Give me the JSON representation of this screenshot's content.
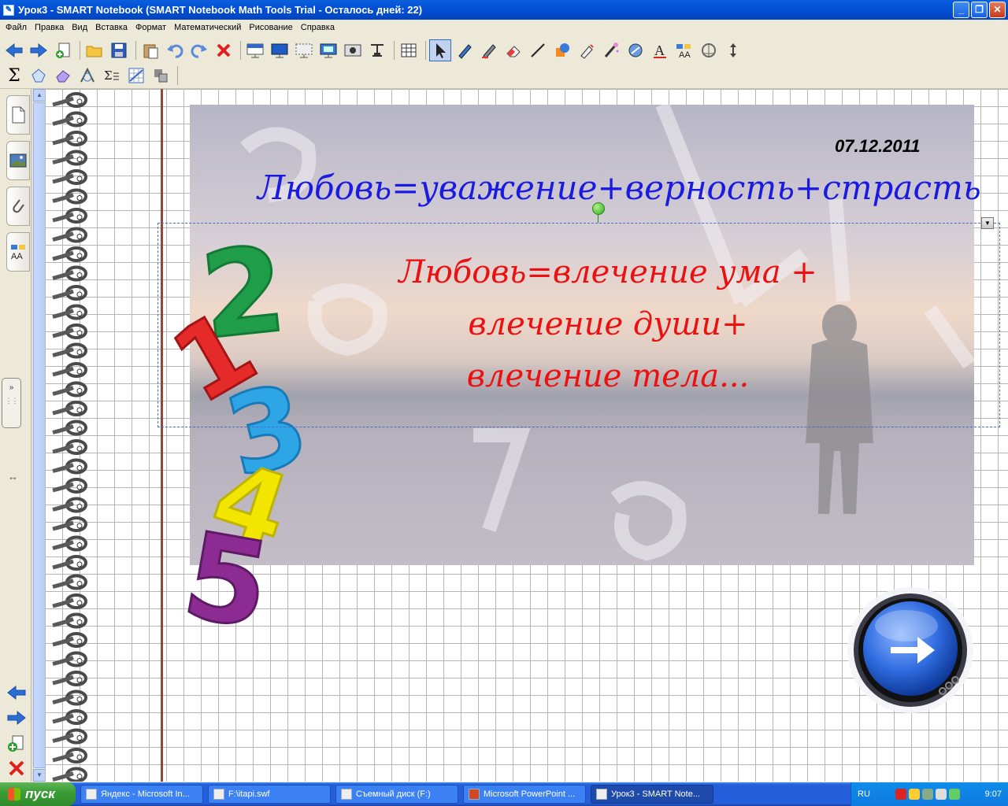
{
  "window": {
    "title": "Урок3 - SMART Notebook (SMART Notebook Math Tools Trial - Осталось дней: 22)"
  },
  "menu": [
    "Файл",
    "Правка",
    "Вид",
    "Вставка",
    "Формат",
    "Математический",
    "Рисование",
    "Справка"
  ],
  "toolbar_icons_row1": [
    "back-arrow-icon",
    "forward-arrow-icon",
    "add-page-icon",
    "open-folder-icon",
    "save-icon",
    "paste-icon",
    "undo-icon",
    "redo-icon",
    "delete-icon",
    "screen-shade-icon",
    "full-screen-icon",
    "transparent-bg-icon",
    "display-icon",
    "capture-icon",
    "document-camera-icon",
    "table-icon",
    "select-pointer-icon",
    "pen-icon",
    "creative-pen-icon",
    "eraser-icon",
    "line-icon",
    "shapes-icon",
    "fill-icon",
    "magic-pen-icon",
    "properties-icon",
    "text-icon",
    "table-text-icon",
    "measure-icon",
    "toolbar-move-icon"
  ],
  "toolbar_icons_row2": [
    "sigma-icon",
    "shape-recognition-icon",
    "eraser-shape-icon",
    "geometry-icon",
    "equation-icon",
    "graph-icon",
    "math-tools-icon"
  ],
  "colors": {
    "title_blue": "#1a1ae0",
    "body_red": "#ec1010"
  },
  "slide": {
    "date": "07.12.2011",
    "title": "Любовь=уважение+верность+страсть",
    "body_lines": [
      "Любовь=влечение ума +",
      "влечение души+",
      "влечение тела..."
    ]
  },
  "taskbar": {
    "start_label": "пуск",
    "tasks": [
      "Яндекс - Microsoft In...",
      "F:\\itapi.swf",
      "Съемный диск (F:)",
      "Microsoft PowerPoint ...",
      "Урок3 - SMART Note..."
    ],
    "language": "RU",
    "clock": "9:07"
  }
}
